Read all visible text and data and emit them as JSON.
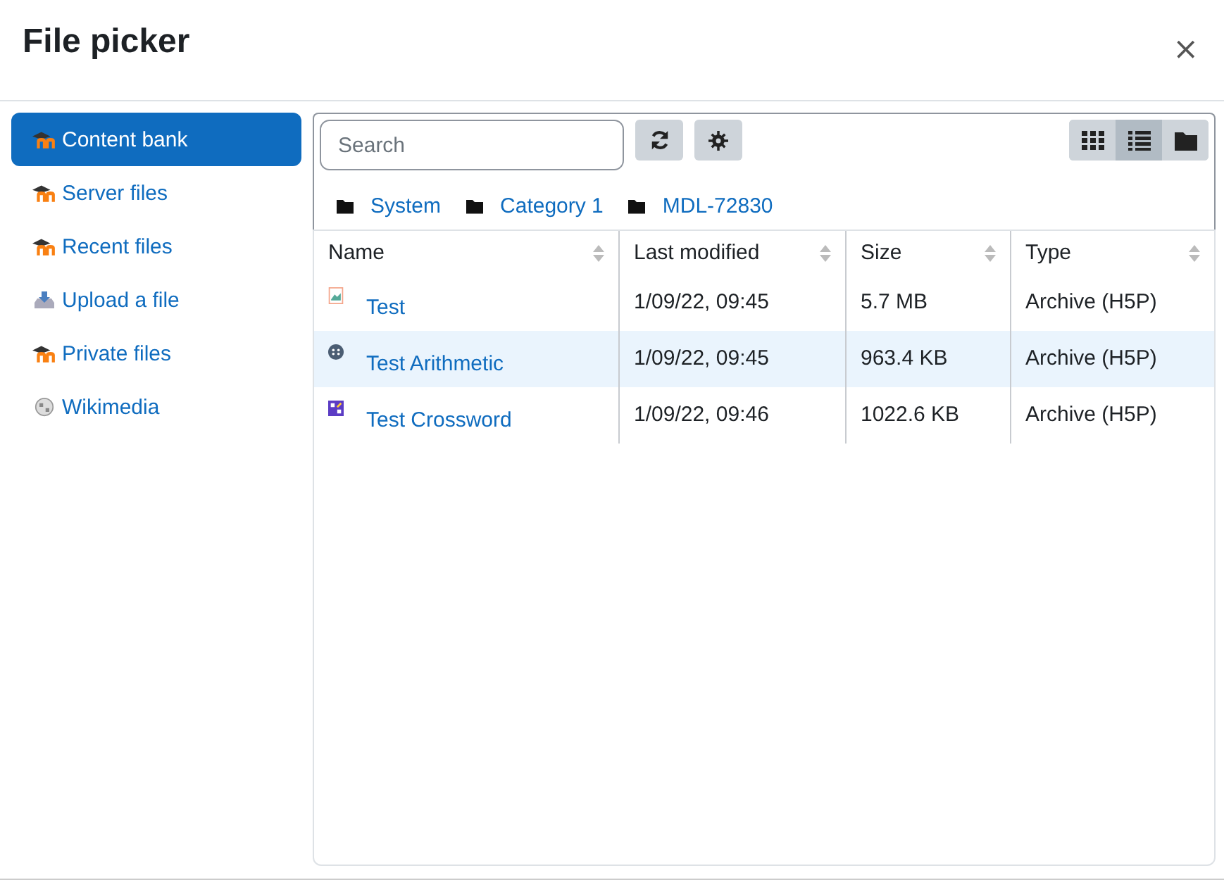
{
  "window": {
    "title": "File picker",
    "close": "×"
  },
  "sidebar": {
    "items": [
      {
        "label": "Content bank",
        "kind": "moodle",
        "selected": true
      },
      {
        "label": "Server files",
        "kind": "moodle",
        "selected": false
      },
      {
        "label": "Recent files",
        "kind": "moodle",
        "selected": false
      },
      {
        "label": "Upload a file",
        "kind": "upload",
        "selected": false
      },
      {
        "label": "Private files",
        "kind": "moodle",
        "selected": false
      },
      {
        "label": "Wikimedia",
        "kind": "wiki",
        "selected": false
      }
    ]
  },
  "search": {
    "placeholder": "Search"
  },
  "views": [
    {
      "kind": "icons",
      "selected": false
    },
    {
      "kind": "list",
      "selected": true
    },
    {
      "kind": "tree",
      "selected": false
    }
  ],
  "breadcrumb": [
    "System",
    "Category 1",
    "MDL-72830"
  ],
  "table": {
    "columns": [
      "Name",
      "Last modified",
      "Size",
      "Type"
    ],
    "rows": [
      {
        "kind": "image",
        "name": "Test",
        "modified": "1/09/22, 09:45",
        "size": "5.7 MB",
        "type": "Archive (H5P)",
        "selected": false
      },
      {
        "kind": "dots",
        "name": "Test Arithmetic",
        "modified": "1/09/22, 09:45",
        "size": "963.4 KB",
        "type": "Archive (H5P)",
        "selected": true
      },
      {
        "kind": "crossword",
        "name": "Test Crossword",
        "modified": "1/09/22, 09:46",
        "size": "1022.6 KB",
        "type": "Archive (H5P)",
        "selected": false
      }
    ]
  }
}
